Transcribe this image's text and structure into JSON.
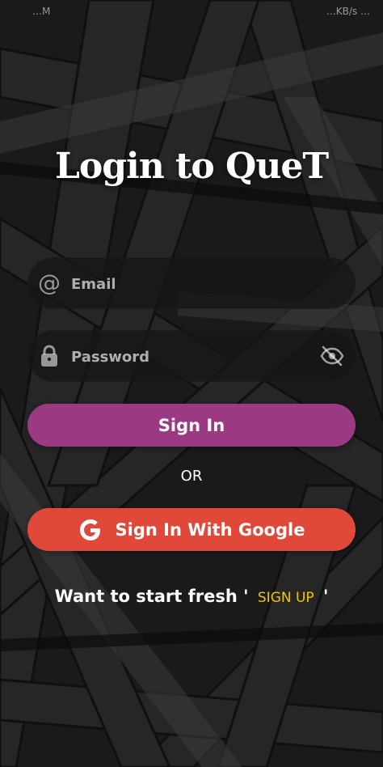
{
  "status_bar": {
    "left": "…M",
    "right": "…KB/s  …"
  },
  "login": {
    "title": "Login to QueT",
    "email_placeholder": "Email",
    "password_placeholder": "Password",
    "signin_label": "Sign In",
    "or_label": "OR",
    "google_label": "Sign In With Google",
    "signup_prompt": "Want to start fresh '",
    "signup_link": "SIGN UP",
    "signup_suffix": "'"
  },
  "icons": {
    "email": "at-icon",
    "password": "lock-icon",
    "visibility": "eye-off-icon",
    "google": "google-icon"
  },
  "colors": {
    "signin_button": "#9b3a82",
    "google_button": "#e0493a",
    "signup_link": "#f0c400"
  }
}
